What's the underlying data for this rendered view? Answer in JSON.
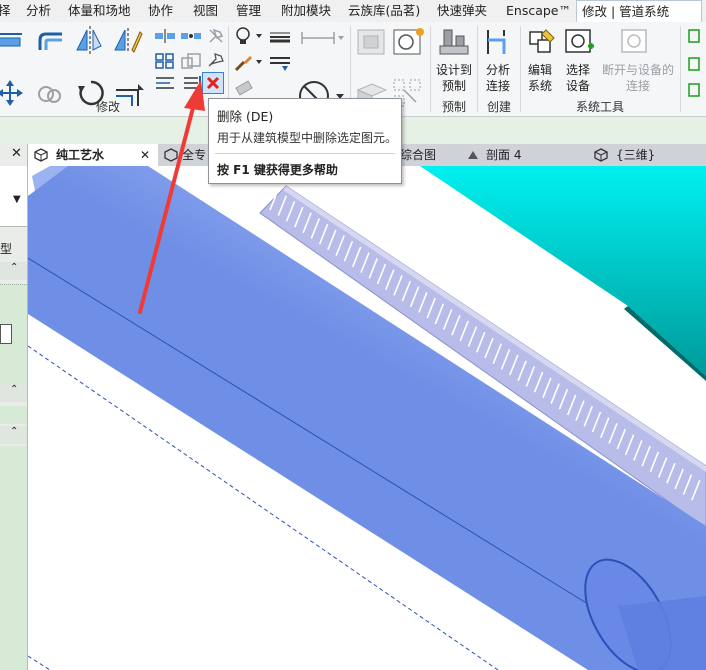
{
  "menu": {
    "tabs": [
      "择",
      "分析",
      "体量和场地",
      "协作",
      "视图",
      "管理",
      "附加模块",
      "云族库(品茗)",
      "快速弹夹",
      "Enscape™",
      "修改 | 管道系统"
    ],
    "active_index": 10
  },
  "ribbon": {
    "panels": {
      "modify": "修改",
      "prefab": "预制",
      "create": "创建",
      "system_tools": "系统工具"
    },
    "buttons": {
      "design_to_prefab": "设计到\n预制",
      "analyze_connections": "分析\n连接",
      "edit_system": "编辑\n系统",
      "select_equipment": "选择\n设备",
      "disconnect_from_equipment": "断开与设备的\n连接"
    }
  },
  "view_tabs": [
    {
      "label": "纯工艺水",
      "icon": "view-3d-icon",
      "active": true
    },
    {
      "label": "全专",
      "icon": "view-3d-icon",
      "active": false
    },
    {
      "label": "综合图",
      "icon": "plan-view-icon",
      "active": false
    },
    {
      "label": "剖面 4",
      "icon": "section-view-icon",
      "active": false
    },
    {
      "label": "{三维}",
      "icon": "view-3d-icon",
      "active": false
    }
  ],
  "left_panel": {
    "fragment_label": "型"
  },
  "tooltip": {
    "title": "删除 (DE)",
    "description": "用于从建筑模型中删除选定图元。",
    "help_hint": "按 F1 键获得更多帮助"
  },
  "colors": {
    "pipe": "#8aa6ee",
    "cyan_duct": "#00e0e0",
    "tray": "#b8bce8",
    "delete_icon_red": "#e8201c",
    "arrow_red": "#ef3b36"
  }
}
